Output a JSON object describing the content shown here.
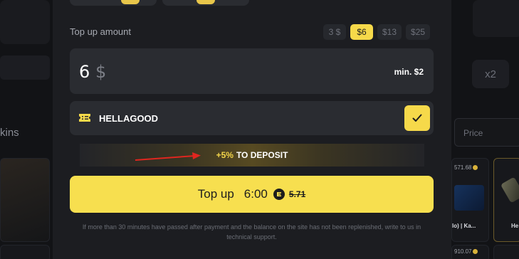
{
  "background": {
    "x2_label": "x2",
    "skins_label": "kins",
    "price_placeholder": "Price",
    "card_price_1": "571.68",
    "card_price_2": "910.07",
    "card_caption_1": "lo) | Ka...",
    "card_caption_2": "He"
  },
  "topup": {
    "amount_label": "Top up amount",
    "presets": [
      "3 $",
      "$6",
      "$13",
      "$25"
    ],
    "active_preset_index": 1,
    "amount_value": "6",
    "amount_currency": "$",
    "min_label": "min. $2",
    "promo_code": "HELLAGOOD",
    "bonus_percent": "+5%",
    "bonus_text": "TO DEPOSIT",
    "button_label": "Top up",
    "button_price": "6:00",
    "old_price": "5.71",
    "footnote": "If more than 30 minutes have passed after payment and the balance on the site has not been replenished, write to us in technical support."
  },
  "colors": {
    "accent": "#f7df4f",
    "modal_bg": "#1c1d21",
    "field_bg": "#2a2c31",
    "arrow": "#e0261f"
  },
  "icons": {
    "promo": "ticket-icon",
    "apply": "check-icon",
    "currency": "coin-icon",
    "annotation": "red-arrow"
  }
}
